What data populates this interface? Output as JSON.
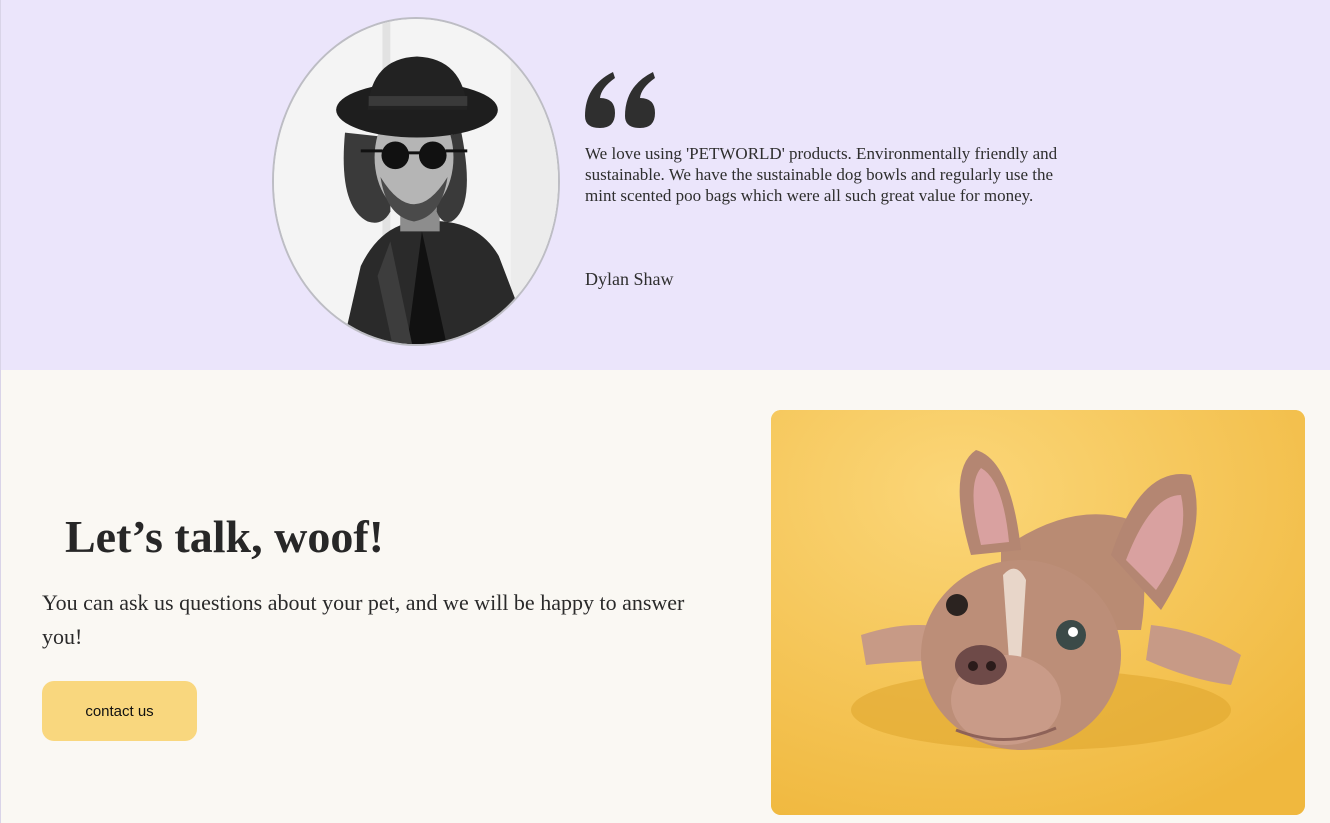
{
  "testimonial": {
    "avatar_alt": "black and white portrait of a man in a hat and sunglasses",
    "quote_icon": "quote-icon",
    "text": "We love using 'PETWORLD' products. Environmentally friendly and sustainable. We have the sustainable dog bowls and regularly use the mint scented poo bags which were all such great value for money.",
    "author": "Dylan Shaw",
    "colors": {
      "background": "#ebe5fb"
    }
  },
  "contact": {
    "title": "Let’s talk, woof!",
    "text": "You can ask us questions about your pet, and we will be happy to answer you!",
    "button_label": "contact us",
    "photo_alt": "puppy lying on a yellow background",
    "colors": {
      "background": "#faf8f3",
      "button": "#f9d77e",
      "photo_bg": "#f5c451"
    }
  }
}
